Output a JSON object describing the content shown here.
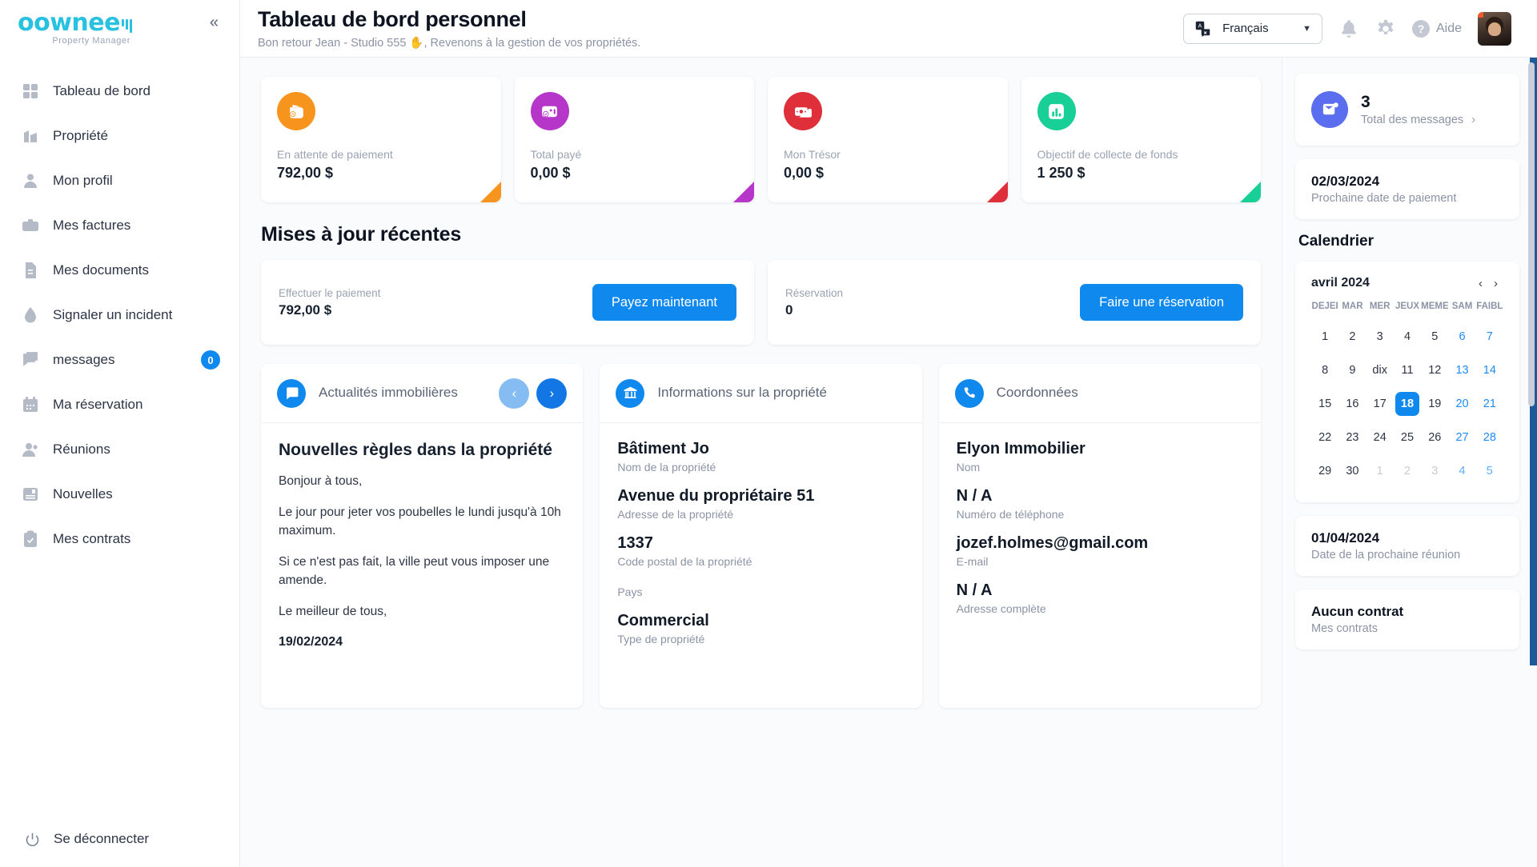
{
  "brand": {
    "name": "oownee",
    "tagline": "Property Manager"
  },
  "sidebar": {
    "collapse_icon": "chevrons-left-icon",
    "items": [
      {
        "label": "Tableau de bord",
        "icon": "dashboard-grid-icon"
      },
      {
        "label": "Propriété",
        "icon": "building-icon"
      },
      {
        "label": "Mon profil",
        "icon": "user-icon"
      },
      {
        "label": "Mes factures",
        "icon": "briefcase-icon"
      },
      {
        "label": "Mes documents",
        "icon": "document-icon"
      },
      {
        "label": "Signaler un incident",
        "icon": "water-drop-icon"
      },
      {
        "label": "messages",
        "icon": "chat-bubble-icon",
        "badge": "0"
      },
      {
        "label": "Ma réservation",
        "icon": "calendar-icon"
      },
      {
        "label": "Réunions",
        "icon": "users-icon"
      },
      {
        "label": "Nouvelles",
        "icon": "news-icon"
      },
      {
        "label": "Mes contrats",
        "icon": "clipboard-check-icon"
      }
    ],
    "logout": {
      "label": "Se déconnecter",
      "icon": "power-icon"
    }
  },
  "header": {
    "title": "Tableau de bord personnel",
    "subtitle": "Bon retour Jean - Studio 555 ✋, Revenons à la gestion de vos propriétés.",
    "language": {
      "value": "Français",
      "icon": "translate-icon",
      "chevron": "chevron-down-icon"
    },
    "notifications_icon": "bell-icon",
    "settings_icon": "gear-icon",
    "help": {
      "label": "Aide",
      "icon": "question-circle-icon"
    },
    "avatar_icon": "user-avatar"
  },
  "stats": [
    {
      "label": "En attente de paiement",
      "value": "792,00 $",
      "color": "#f7941e",
      "icon": "wallet-clock-icon"
    },
    {
      "label": "Total payé",
      "value": "0,00 $",
      "color": "#b536c9",
      "icon": "card-check-icon"
    },
    {
      "label": "Mon Trésor",
      "value": "0,00 $",
      "color": "#de2f3a",
      "icon": "money-stack-icon"
    },
    {
      "label": "Objectif de collecte de fonds",
      "value": "1 250 $",
      "color": "#17cf97",
      "icon": "bar-chart-icon"
    }
  ],
  "updates": {
    "title": "Mises à jour récentes",
    "cards": [
      {
        "label": "Effectuer le paiement",
        "value": "792,00 $",
        "button": "Payez maintenant"
      },
      {
        "label": "Réservation",
        "value": "0",
        "button": "Faire une réservation"
      }
    ]
  },
  "news_panel": {
    "title": "Actualités immobilières",
    "icon": "message-square-icon",
    "prev_icon": "chevron-left-icon",
    "next_icon": "chevron-right-icon",
    "article": {
      "title": "Nouvelles règles dans la propriété",
      "paragraphs": [
        "Bonjour à tous,",
        "Le jour pour jeter vos poubelles le lundi jusqu'à 10h maximum.",
        "Si ce n'est pas fait, la ville peut vous imposer une amende.",
        "Le meilleur de tous,"
      ],
      "date": "19/02/2024"
    }
  },
  "property_panel": {
    "title": "Informations sur la propriété",
    "icon": "bank-building-icon",
    "fields": [
      {
        "value": "Bâtiment Jo",
        "key": "Nom de la propriété"
      },
      {
        "value": "Avenue du propriétaire 51",
        "key": "Adresse de la propriété"
      },
      {
        "value": "1337",
        "key": "Code postal de la propriété"
      },
      {
        "value": "",
        "key": "Pays"
      },
      {
        "value": "Commercial",
        "key": "Type de propriété"
      }
    ]
  },
  "contact_panel": {
    "title": "Coordonnées",
    "icon": "phone-icon",
    "fields": [
      {
        "value": "Elyon Immobilier",
        "key": "Nom"
      },
      {
        "value": "N / A",
        "key": "Numéro de téléphone"
      },
      {
        "value": "jozef.holmes@gmail.com",
        "key": "E-mail"
      },
      {
        "value": "N / A",
        "key": "Adresse complète"
      }
    ]
  },
  "rail": {
    "messages": {
      "count": "3",
      "label": "Total des messages",
      "icon": "mail-icon",
      "go_icon": "chevron-right-icon"
    },
    "next_payment": {
      "date": "02/03/2024",
      "label": "Prochaine date de paiement"
    },
    "calendar_title": "Calendrier",
    "calendar": {
      "month": "avril 2024",
      "prev_icon": "chevron-left-icon",
      "next_icon": "chevron-right-icon",
      "weekdays": [
        "DÉJEI",
        "MAR",
        "MER",
        "JEUX",
        "MÊME",
        "SAM",
        "FAIBL"
      ],
      "weeks": [
        [
          {
            "d": "1"
          },
          {
            "d": "2"
          },
          {
            "d": "3"
          },
          {
            "d": "4"
          },
          {
            "d": "5"
          },
          {
            "d": "6",
            "wknd": true
          },
          {
            "d": "7",
            "wknd": true
          }
        ],
        [
          {
            "d": "8"
          },
          {
            "d": "9"
          },
          {
            "d": "dix"
          },
          {
            "d": "11"
          },
          {
            "d": "12"
          },
          {
            "d": "13",
            "wknd": true
          },
          {
            "d": "14",
            "wknd": true
          }
        ],
        [
          {
            "d": "15"
          },
          {
            "d": "16"
          },
          {
            "d": "17"
          },
          {
            "d": "18",
            "today": true
          },
          {
            "d": "19"
          },
          {
            "d": "20",
            "wknd": true
          },
          {
            "d": "21",
            "wknd": true
          }
        ],
        [
          {
            "d": "22"
          },
          {
            "d": "23"
          },
          {
            "d": "24"
          },
          {
            "d": "25"
          },
          {
            "d": "26"
          },
          {
            "d": "27",
            "wknd": true
          },
          {
            "d": "28",
            "wknd": true
          }
        ],
        [
          {
            "d": "29"
          },
          {
            "d": "30"
          },
          {
            "d": "1",
            "out": true
          },
          {
            "d": "2",
            "out": true
          },
          {
            "d": "3",
            "out": true
          },
          {
            "d": "4",
            "out": true,
            "wknd": true
          },
          {
            "d": "5",
            "out": true,
            "wknd": true
          }
        ]
      ]
    },
    "next_meeting": {
      "date": "01/04/2024",
      "label": "Date de la prochaine réunion"
    },
    "contracts": {
      "title": "Aucun contrat",
      "label": "Mes contrats"
    }
  }
}
